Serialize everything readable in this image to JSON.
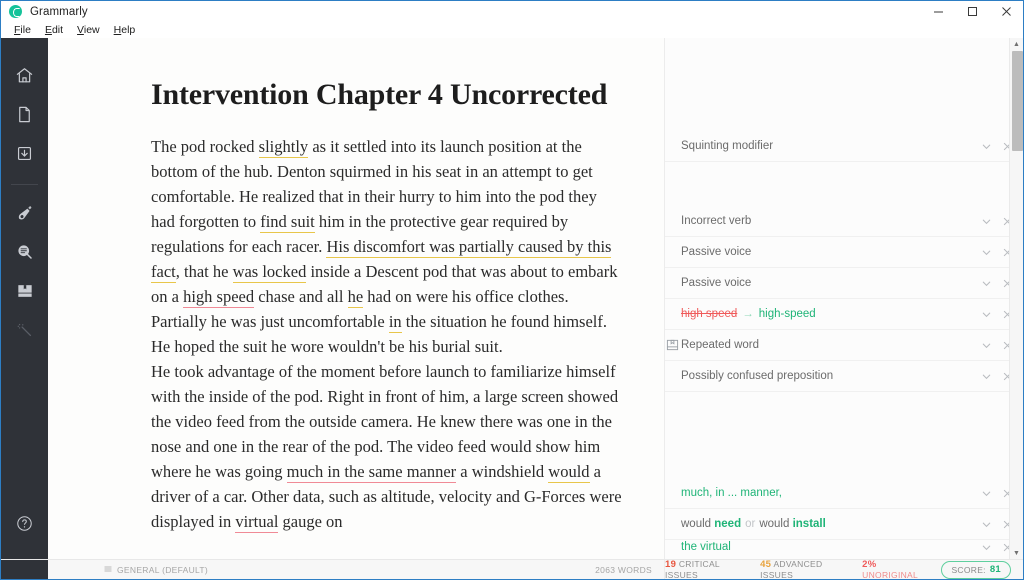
{
  "window": {
    "app_title": "Grammarly",
    "logo_icon": "grammarly-logo",
    "controls": {
      "minimize": "minimize-icon",
      "maximize": "maximize-icon",
      "close": "close-icon"
    }
  },
  "menu": {
    "items": [
      {
        "label": "File",
        "accel": "F"
      },
      {
        "label": "Edit",
        "accel": "E"
      },
      {
        "label": "View",
        "accel": "V"
      },
      {
        "label": "Help",
        "accel": "H"
      }
    ]
  },
  "sidebar": {
    "items": [
      {
        "icon": "home-icon",
        "name": "sidebar-item-home",
        "dim": false
      },
      {
        "icon": "document-icon",
        "name": "sidebar-item-documents",
        "dim": false
      },
      {
        "icon": "download-icon",
        "name": "sidebar-item-download",
        "dim": false
      },
      {
        "icon": "pen-nib-icon",
        "name": "sidebar-item-correctness",
        "dim": false
      },
      {
        "icon": "search-lines-icon",
        "name": "sidebar-item-clarity",
        "dim": false
      },
      {
        "icon": "book-icon",
        "name": "sidebar-item-vocabulary",
        "dim": false
      },
      {
        "icon": "magic-wand-icon",
        "name": "sidebar-item-enhancements",
        "dim": true
      }
    ],
    "help": {
      "icon": "help-icon",
      "name": "sidebar-item-help"
    }
  },
  "document": {
    "title": "Intervention Chapter 4 Uncorrected",
    "paragraphs": [
      {
        "runs": [
          {
            "text": "The pod rocked "
          },
          {
            "text": "slightly",
            "mark": "yellow"
          },
          {
            "text": " as it settled into its launch position at the bottom of the hub. Denton squirmed in his seat in an attempt to get comfortable. He realized that in their hurry to him into the pod they had forgotten to "
          },
          {
            "text": "find suit",
            "mark": "yellow"
          },
          {
            "text": " him in the protective gear required by regulations for each racer. "
          },
          {
            "text": "His discomfort was partially caused by this fact",
            "mark": "yellow"
          },
          {
            "text": ", that he "
          },
          {
            "text": "was locked",
            "mark": "yellow"
          },
          {
            "text": " inside a Descent pod that was about to embark on a "
          },
          {
            "text": "high speed",
            "mark": "red"
          },
          {
            "text": " chase and all "
          },
          {
            "text": "he",
            "mark": "yellow"
          },
          {
            "text": " had on were his office clothes. Partially he was just uncomfortable "
          },
          {
            "text": "in",
            "mark": "yellow"
          },
          {
            "text": " the situation he found himself. He hoped the suit he wore wouldn't be his burial suit."
          }
        ]
      },
      {
        "runs": [
          {
            "text": "He took advantage of the moment before launch to familiarize himself with the inside of the pod. Right in front of him, a large screen showed the video feed from the outside camera. He knew there was one in the nose and one in the rear of the pod. The video feed would show him where he was going "
          },
          {
            "text": "much in the same manner",
            "mark": "red"
          },
          {
            "text": " a windshield "
          },
          {
            "text": "would",
            "mark": "yellow"
          },
          {
            "text": " a driver of a car. Other data, such as altitude, velocity and G-Forces were displayed in "
          },
          {
            "text": "virtual",
            "mark": "red"
          },
          {
            "text": " gauge on"
          }
        ]
      }
    ],
    "status": {
      "goal_icon": "sliders-icon",
      "goal_label": "GENERAL (DEFAULT)",
      "word_count": "2063 WORDS"
    }
  },
  "suggestions": {
    "cards": [
      {
        "kind": "plain",
        "label": "Squinting modifier",
        "icon": null,
        "gap_after": true
      },
      {
        "kind": "plain",
        "label": "Incorrect verb",
        "icon": null
      },
      {
        "kind": "plain",
        "label": "Passive voice",
        "icon": null
      },
      {
        "kind": "plain",
        "label": "Passive voice",
        "icon": null
      },
      {
        "kind": "replace",
        "deleted": "high speed",
        "arrow": "→",
        "inserted": "high-speed",
        "icon": null
      },
      {
        "kind": "plain",
        "label": "Repeated word",
        "icon": "book-small-icon"
      },
      {
        "kind": "plain",
        "label": "Possibly confused preposition",
        "icon": null,
        "gap_after_large": true
      },
      {
        "kind": "green",
        "label": "much, in ... manner,",
        "icon": null
      },
      {
        "kind": "alternatives",
        "prefix1": "would ",
        "word1": "need",
        "or": "or",
        "prefix2": "would ",
        "word2": "install",
        "icon": null
      },
      {
        "kind": "green",
        "label": "the virtual",
        "icon": null,
        "clipped": true
      }
    ],
    "actions": {
      "expand": "chevron-down-icon",
      "dismiss": "close-icon"
    },
    "scrollbar": {
      "up": "scroll-up-arrow",
      "down": "scroll-down-arrow"
    }
  },
  "footer": {
    "critical_count": "19",
    "critical_label": "CRITICAL ISSUES",
    "advanced_count": "45",
    "advanced_label": "ADVANCED ISSUES",
    "unoriginal_count": "2%",
    "unoriginal_label": "UNORIGINAL",
    "score_label": "SCORE:",
    "score_value": "81"
  },
  "colors": {
    "brand_green": "#15c39a",
    "accent_green": "#1fb477",
    "critical_red": "#e8563f",
    "advanced_orange": "#e8a33d",
    "rail_bg": "#2f3238",
    "mark_yellow": "#e8c64a",
    "mark_red": "#f08a96"
  }
}
